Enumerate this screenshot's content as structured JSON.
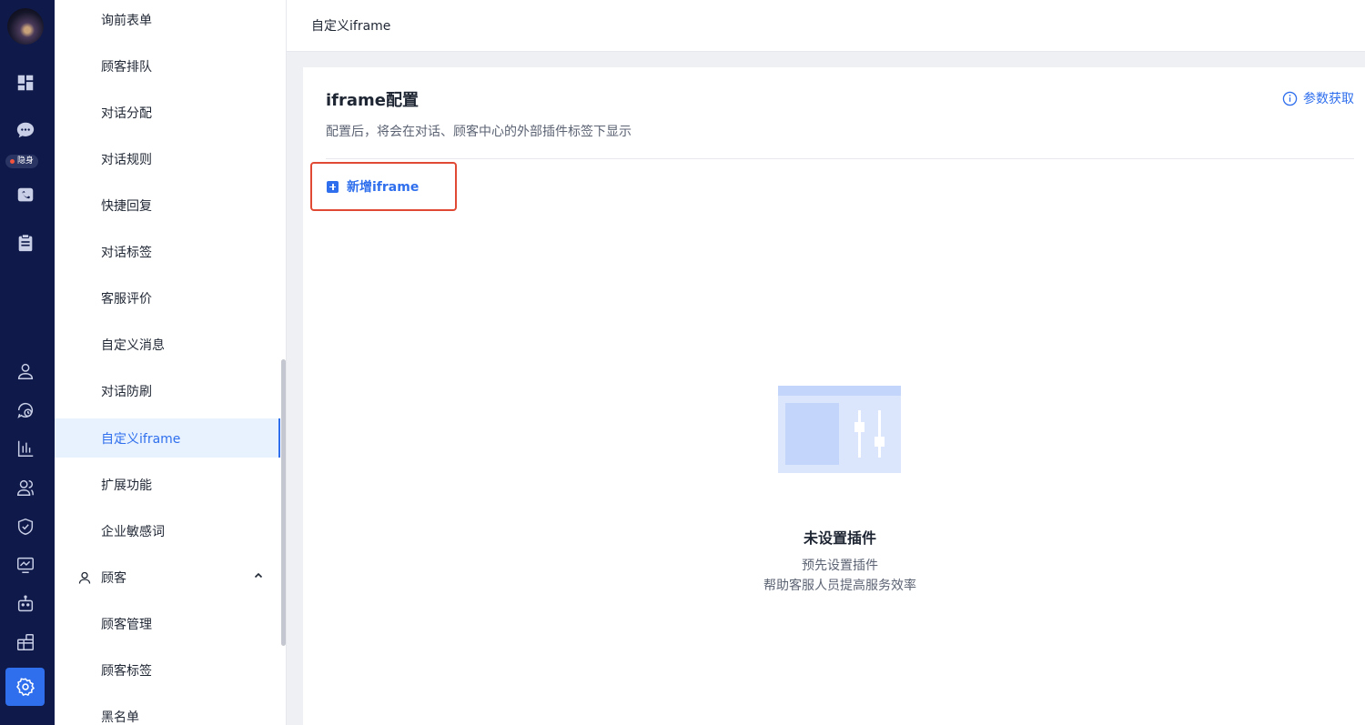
{
  "rail": {
    "status_badge": "隐身",
    "icons": [
      "dashboard-icon",
      "chat-icon",
      "phone-icon",
      "clipboard-icon",
      "user-icon",
      "history-icon",
      "chart-icon",
      "team-icon",
      "shield-icon",
      "monitor-icon",
      "robot-icon",
      "gift-icon",
      "settings-icon"
    ]
  },
  "menu": {
    "items": [
      {
        "label": "询前表单"
      },
      {
        "label": "顾客排队"
      },
      {
        "label": "对话分配"
      },
      {
        "label": "对话规则"
      },
      {
        "label": "快捷回复"
      },
      {
        "label": "对话标签"
      },
      {
        "label": "客服评价"
      },
      {
        "label": "自定义消息"
      },
      {
        "label": "对话防刷"
      },
      {
        "label": "自定义iframe",
        "active": true
      },
      {
        "label": "扩展功能"
      },
      {
        "label": "企业敏感词"
      }
    ],
    "group": {
      "label": "顾客",
      "icon": "user-outline-icon"
    },
    "group_items": [
      {
        "label": "顾客管理"
      },
      {
        "label": "顾客标签"
      },
      {
        "label": "黑名单"
      }
    ]
  },
  "header": {
    "breadcrumb": "自定义iframe"
  },
  "card": {
    "title": "iframe配置",
    "description": "配置后，将会在对话、顾客中心的外部插件标签下显示",
    "help_link": "参数获取",
    "add_button": "新增iframe"
  },
  "empty": {
    "title": "未设置插件",
    "line1": "预先设置插件",
    "line2": "帮助客服人员提高服务效率"
  },
  "colors": {
    "rail_bg": "#0f1a4a",
    "accent": "#2f6fed",
    "highlight_border": "#e04a35",
    "active_menu_bg": "#e8f2fe"
  }
}
